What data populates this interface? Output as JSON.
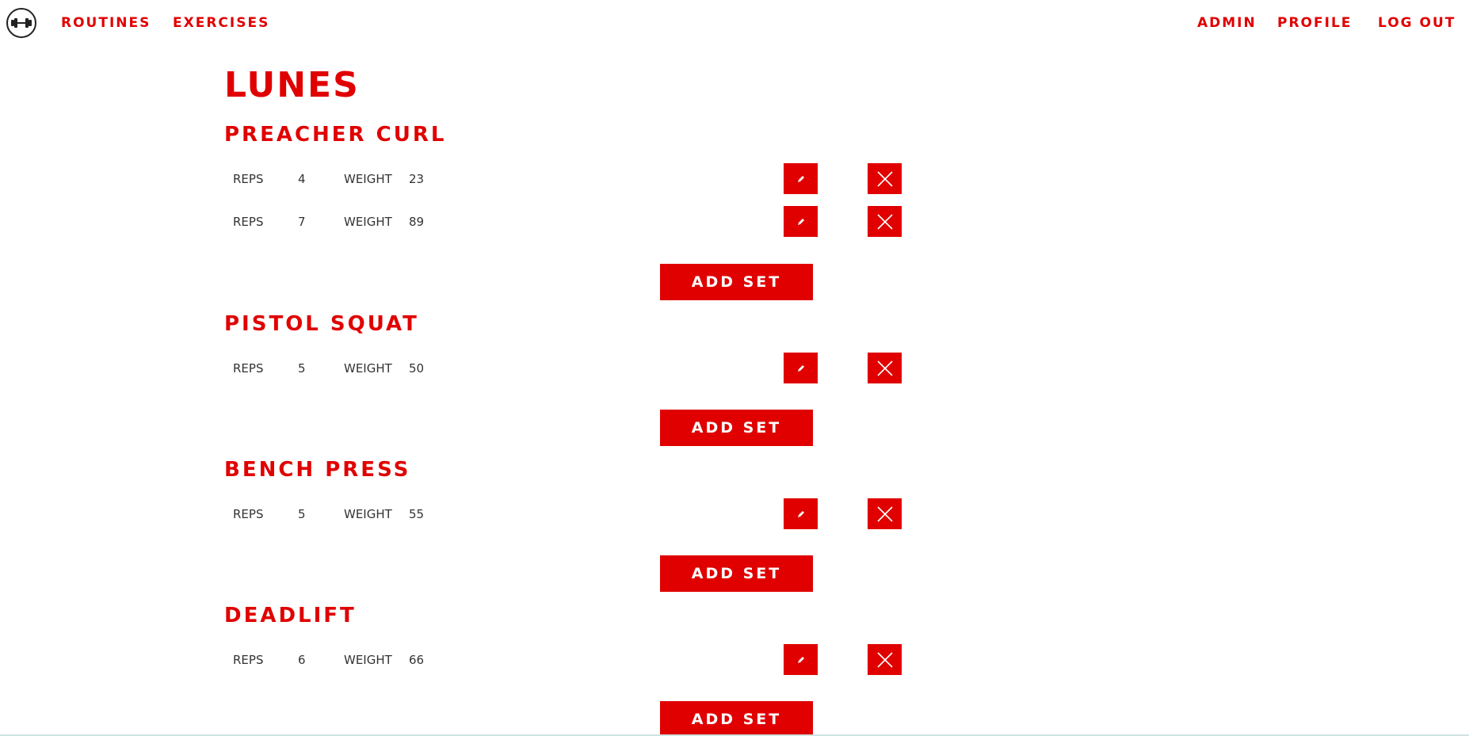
{
  "nav": {
    "logo_icon": "dumbbell-icon",
    "routines": "ROUTINES",
    "exercises": "EXERCISES",
    "admin": "ADMIN",
    "profile": "PROFILE",
    "logout": "LOG OUT"
  },
  "routine": {
    "title": "LUNES"
  },
  "exercises": [
    {
      "name": "PREACHER CURL",
      "sets": [
        {
          "reps_label": "REPS",
          "reps": "4",
          "weight_label": "WEIGHT",
          "weight": "23"
        },
        {
          "reps_label": "REPS",
          "reps": "7",
          "weight_label": "WEIGHT",
          "weight": "89"
        }
      ],
      "add_label": "ADD SET"
    },
    {
      "name": "PISTOL SQUAT",
      "sets": [
        {
          "reps_label": "REPS",
          "reps": "5",
          "weight_label": "WEIGHT",
          "weight": "50"
        }
      ],
      "add_label": "ADD SET"
    },
    {
      "name": "BENCH PRESS",
      "sets": [
        {
          "reps_label": "REPS",
          "reps": "5",
          "weight_label": "WEIGHT",
          "weight": "55"
        }
      ],
      "add_label": "ADD SET"
    },
    {
      "name": "DEADLIFT",
      "sets": [
        {
          "reps_label": "REPS",
          "reps": "6",
          "weight_label": "WEIGHT",
          "weight": "66"
        }
      ],
      "add_label": "ADD SET"
    }
  ],
  "icons": {
    "edit": "pencil-icon",
    "delete": "close-icon"
  },
  "colors": {
    "accent": "#e00000",
    "text": "#333333",
    "background": "#ffffff"
  }
}
